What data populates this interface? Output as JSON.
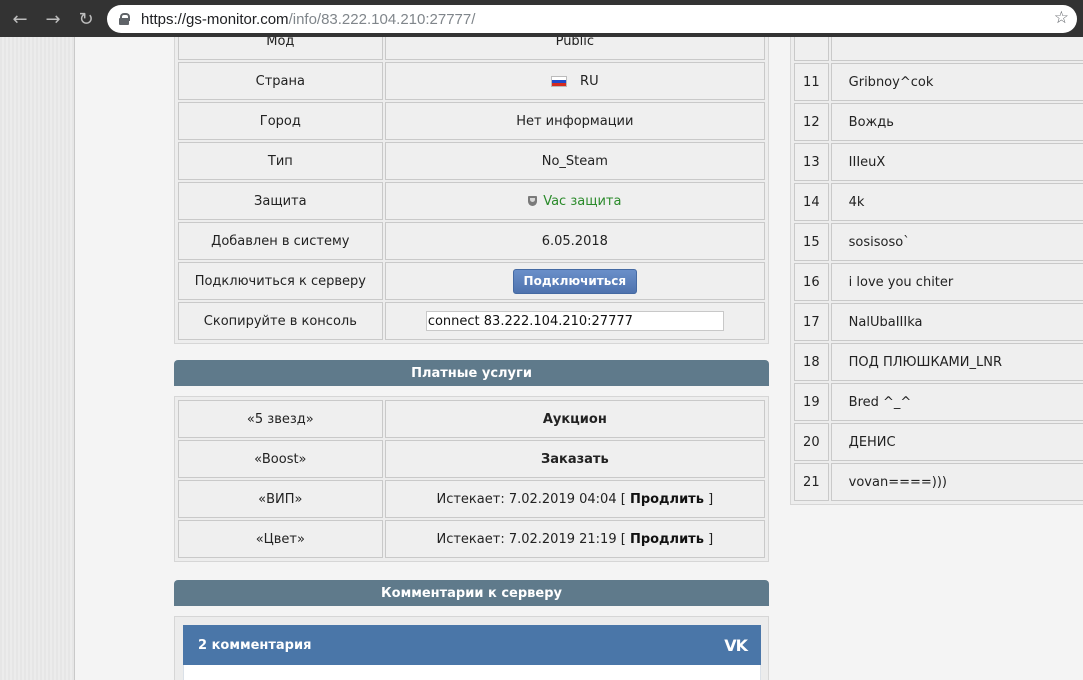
{
  "browser": {
    "back_icon": "←",
    "forward_icon": "→",
    "reload_icon": "↻",
    "url_host": "https://gs-monitor.com",
    "url_path": "/info/83.222.104.210:27777/",
    "star_icon": "☆"
  },
  "info": {
    "rows": [
      {
        "label": "Мод",
        "value": "Public"
      },
      {
        "label": "Страна",
        "value": "RU"
      },
      {
        "label": "Город",
        "value": "Нет информации"
      },
      {
        "label": "Тип",
        "value": "No_Steam"
      },
      {
        "label": "Защита",
        "value": "Vac защита"
      },
      {
        "label": "Добавлен в систему",
        "value": "6.05.2018"
      },
      {
        "label": "Подключиться к серверу",
        "value": "Подключиться"
      },
      {
        "label": "Скопируйте в консоль",
        "value": "connect 83.222.104.210:27777"
      }
    ],
    "flag_colors": [
      "#ffffff",
      "#2149c9",
      "#d52b1e"
    ],
    "vac_color": "#2a8a2a"
  },
  "paid": {
    "title": "Платные услуги",
    "rows": [
      {
        "label": "«5 звезд»",
        "value": "Аукцион"
      },
      {
        "label": "«Boost»",
        "value": "Заказать"
      },
      {
        "label": "«ВИП»",
        "prefix": "Истекает: 7.02.2019 04:04 [ ",
        "link": "Продлить",
        "suffix": " ]"
      },
      {
        "label": "«Цвет»",
        "prefix": "Истекает: 7.02.2019 21:19 [ ",
        "link": "Продлить",
        "suffix": " ]"
      }
    ]
  },
  "comments": {
    "title": "Комментарии к серверу",
    "count_label": "2 комментария",
    "vk_logo": "VK"
  },
  "players": {
    "rows": [
      {
        "num": "",
        "name": ""
      },
      {
        "num": "11",
        "name": "Gribnoy^cok"
      },
      {
        "num": "12",
        "name": "Вождь"
      },
      {
        "num": "13",
        "name": "IIIeuX"
      },
      {
        "num": "14",
        "name": "4k"
      },
      {
        "num": "15",
        "name": "sosisoso`"
      },
      {
        "num": "16",
        "name": "i love you chiter"
      },
      {
        "num": "17",
        "name": "NalUbaIIIka"
      },
      {
        "num": "18",
        "name": "ПОД ПЛЮШКАМИ_LNR"
      },
      {
        "num": "19",
        "name": "Bred ^_^"
      },
      {
        "num": "20",
        "name": "ДЕНИС"
      },
      {
        "num": "21",
        "name": "vovan====)))"
      }
    ]
  }
}
